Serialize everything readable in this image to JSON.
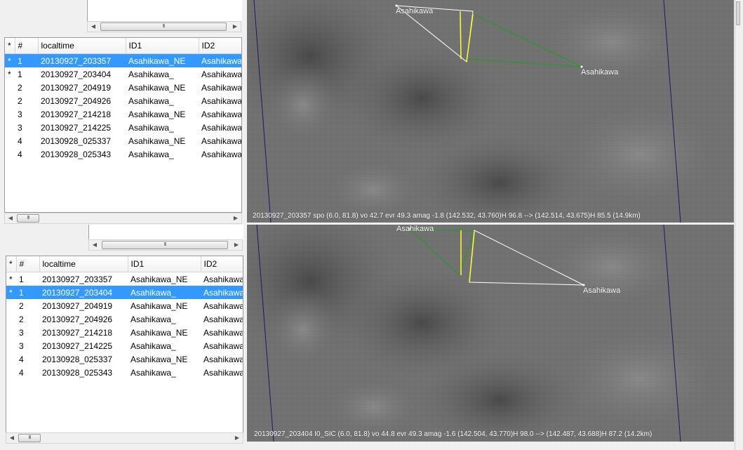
{
  "columns": [
    "*",
    "#",
    "localtime",
    "ID1",
    "ID2"
  ],
  "table_top": {
    "selected_index": 0,
    "rows": [
      {
        "star": "*",
        "num": "1",
        "localtime": "20130927_203357",
        "id1": "Asahikawa_NE",
        "id2": "Asahikawa"
      },
      {
        "star": "*",
        "num": "1",
        "localtime": "20130927_203404",
        "id1": "Asahikawa_",
        "id2": "Asahikawa"
      },
      {
        "star": "",
        "num": "2",
        "localtime": "20130927_204919",
        "id1": "Asahikawa_NE",
        "id2": "Asahikawa"
      },
      {
        "star": "",
        "num": "2",
        "localtime": "20130927_204926",
        "id1": "Asahikawa_",
        "id2": "Asahikawa"
      },
      {
        "star": "",
        "num": "3",
        "localtime": "20130927_214218",
        "id1": "Asahikawa_NE",
        "id2": "Asahikawa"
      },
      {
        "star": "",
        "num": "3",
        "localtime": "20130927_214225",
        "id1": "Asahikawa_",
        "id2": "Asahikawa"
      },
      {
        "star": "",
        "num": "4",
        "localtime": "20130928_025337",
        "id1": "Asahikawa_NE",
        "id2": "Asahikawa"
      },
      {
        "star": "",
        "num": "4",
        "localtime": "20130928_025343",
        "id1": "Asahikawa_",
        "id2": "Asahikawa"
      }
    ]
  },
  "table_bottom": {
    "selected_index": 1,
    "rows": [
      {
        "star": "*",
        "num": "1",
        "localtime": "20130927_203357",
        "id1": "Asahikawa_NE",
        "id2": "Asahikawa"
      },
      {
        "star": "*",
        "num": "1",
        "localtime": "20130927_203404",
        "id1": "Asahikawa_",
        "id2": "Asahikawa"
      },
      {
        "star": "",
        "num": "2",
        "localtime": "20130927_204919",
        "id1": "Asahikawa_NE",
        "id2": "Asahikawa"
      },
      {
        "star": "",
        "num": "2",
        "localtime": "20130927_204926",
        "id1": "Asahikawa_",
        "id2": "Asahikawa"
      },
      {
        "star": "",
        "num": "3",
        "localtime": "20130927_214218",
        "id1": "Asahikawa_NE",
        "id2": "Asahikawa"
      },
      {
        "star": "",
        "num": "3",
        "localtime": "20130927_214225",
        "id1": "Asahikawa_",
        "id2": "Asahikawa"
      },
      {
        "star": "",
        "num": "4",
        "localtime": "20130928_025337",
        "id1": "Asahikawa_NE",
        "id2": "Asahikawa"
      },
      {
        "star": "",
        "num": "4",
        "localtime": "20130928_025343",
        "id1": "Asahikawa_",
        "id2": "Asahikawa"
      }
    ]
  },
  "scroll_thumb_glyph": "III",
  "view_top": {
    "station_a": "Asahikawa",
    "station_b": "Asahikawa",
    "caption": "20130927_203357  spo (6.0, 81.8) vo 42.7 evr 49.3 amag -1.8  (142.532, 43.760)H 96.8 --> (142.514, 43.675)H 85.5 (14.9km)"
  },
  "view_bottom": {
    "station_a": "Asahikawa",
    "station_b": "Asahikawa",
    "caption": "20130927_203404  I0_SIC (6.0, 81.8) vo 44.8 evr 49.3 amag -1.6  (142.504, 43.770)H 98.0 --> (142.487, 43.688)H 87.2 (14.2km)"
  },
  "colors": {
    "selection": "#3399ff",
    "ray_white": "#ffffff",
    "ray_green": "#1aa01a",
    "track_yellow": "#ffff33",
    "grid_line": "#1a1a66"
  }
}
